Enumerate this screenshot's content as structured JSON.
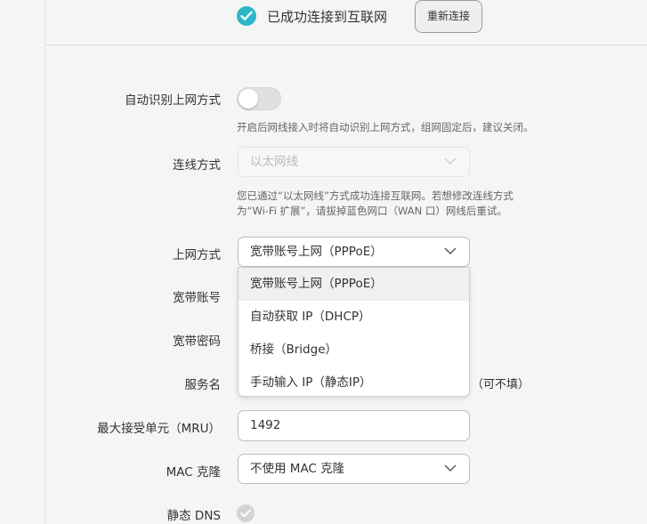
{
  "header": {
    "status_text": "已成功连接到互联网",
    "status_icon": "check-circle-icon",
    "reconnect_label": "重新连接",
    "accent_color": "#2bb6c8"
  },
  "auto_detect": {
    "label": "自动识别上网方式",
    "enabled": false,
    "hint": "开启后网线接入时将自动识别上网方式，组网固定后，建议关闭。"
  },
  "connection_type": {
    "label": "连线方式",
    "value": "以太网线",
    "disabled": true,
    "hint_line1": "您已通过“以太网线”方式成功连接互联网。若想修改连线方式",
    "hint_line2": "为“Wi-Fi 扩展”，请拔掉蓝色网口（WAN 口）网线后重试。"
  },
  "internet_mode": {
    "label": "上网方式",
    "value": "宽带账号上网（PPPoE）",
    "options": [
      "宽带账号上网（PPPoE）",
      "自动获取 IP（DHCP）",
      "桥接（Bridge）",
      "手动输入 IP（静态IP）"
    ],
    "selected_index": 0
  },
  "broadband_account": {
    "label": "宽带账号"
  },
  "broadband_password": {
    "label": "宽带密码"
  },
  "service_name": {
    "label": "服务名",
    "suffix": "（可不填）"
  },
  "mru": {
    "label": "最大接受单元（MRU）",
    "value": "1492"
  },
  "mac_clone": {
    "label": "MAC 克隆",
    "value": "不使用 MAC 克隆"
  },
  "static_dns": {
    "label": "静态 DNS",
    "checked": true
  }
}
